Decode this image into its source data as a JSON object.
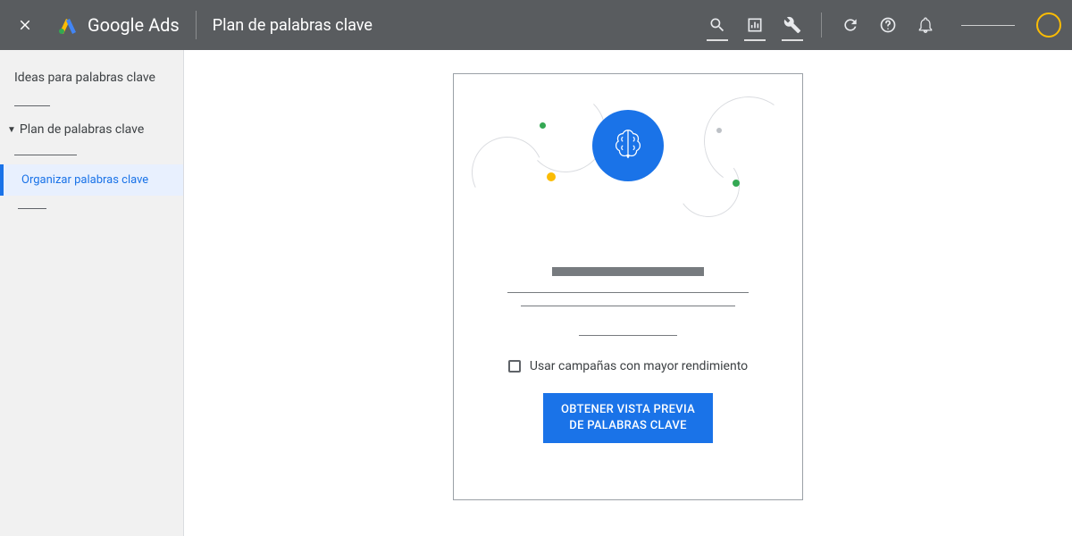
{
  "header": {
    "product_name": "Google Ads",
    "page_title": "Plan de palabras clave"
  },
  "sidebar": {
    "ideas_label": "Ideas para palabras clave",
    "plan_label": "Plan de palabras clave",
    "active_label": "Organizar palabras clave"
  },
  "card": {
    "checkbox_label": "Usar campañas con mayor rendimiento",
    "cta_line1": "OBTENER VISTA PREVIA",
    "cta_line2": "DE PALABRAS CLAVE"
  }
}
